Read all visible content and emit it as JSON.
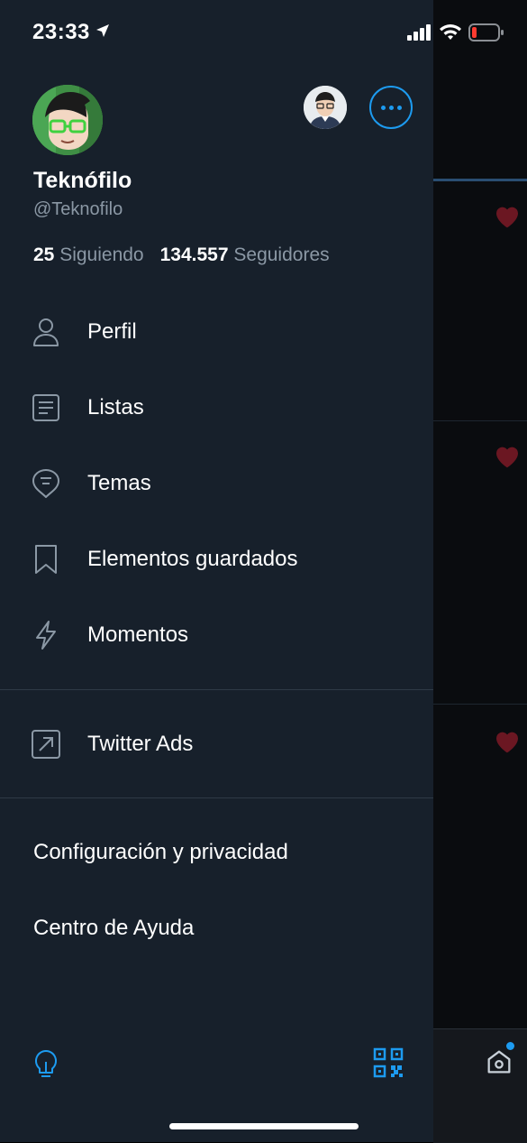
{
  "status_bar": {
    "time": "23:33"
  },
  "profile": {
    "display_name": "Teknófilo",
    "handle": "@Teknofilo",
    "following_count": "25",
    "following_label": "Siguiendo",
    "followers_count": "134.557",
    "followers_label": "Seguidores"
  },
  "menu": {
    "items": [
      {
        "label": "Perfil",
        "icon": "person-icon"
      },
      {
        "label": "Listas",
        "icon": "list-icon"
      },
      {
        "label": "Temas",
        "icon": "topics-icon"
      },
      {
        "label": "Elementos guardados",
        "icon": "bookmark-icon"
      },
      {
        "label": "Momentos",
        "icon": "lightning-icon"
      }
    ],
    "ads": {
      "label": "Twitter Ads",
      "icon": "external-link-icon"
    },
    "settings_label": "Configuración y privacidad",
    "help_label": "Centro de Ayuda"
  },
  "colors": {
    "drawer_bg": "#17202b",
    "accent": "#1d9bf0",
    "secondary_text": "#8b98a5",
    "heart": "#6b1722"
  }
}
